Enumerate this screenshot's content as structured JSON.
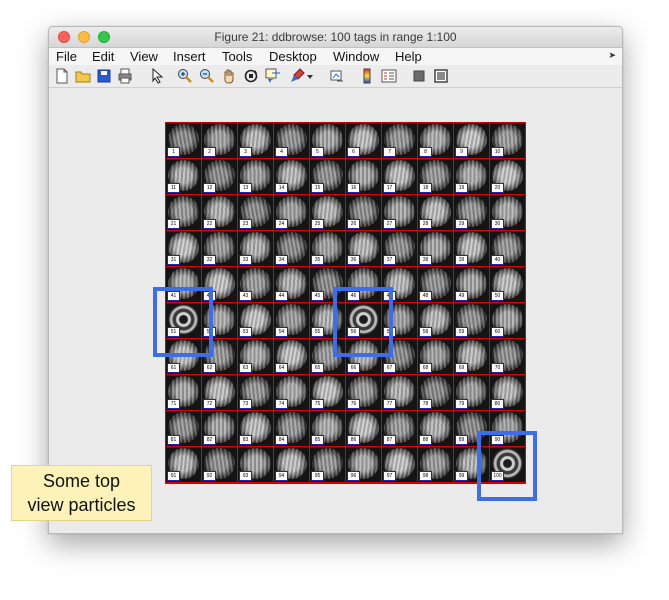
{
  "window": {
    "title": "Figure 21: ddbrowse: 100 tags in range 1:100"
  },
  "menu": {
    "items": [
      "File",
      "Edit",
      "View",
      "Insert",
      "Tools",
      "Desktop",
      "Window",
      "Help"
    ],
    "overflow_icon": "dock-arrow-icon"
  },
  "toolbar": {
    "buttons": [
      {
        "icon": "new-file-icon"
      },
      {
        "icon": "open-folder-icon"
      },
      {
        "icon": "save-icon"
      },
      {
        "icon": "print-icon"
      },
      {
        "icon": "pointer-icon"
      },
      {
        "icon": "zoom-in-icon"
      },
      {
        "icon": "zoom-out-icon"
      },
      {
        "icon": "pan-hand-icon"
      },
      {
        "icon": "rotate-3d-icon"
      },
      {
        "icon": "data-cursor-icon"
      },
      {
        "icon": "brush-icon"
      },
      {
        "icon": "brush-dropdown-icon"
      },
      {
        "icon": "link-plot-icon"
      },
      {
        "icon": "colorbar-icon"
      },
      {
        "icon": "legend-icon"
      },
      {
        "icon": "hide-plot-tools-icon"
      },
      {
        "icon": "show-plot-tools-icon"
      }
    ]
  },
  "gallery": {
    "tags": [
      "1",
      "2",
      "3",
      "4",
      "5",
      "6",
      "7",
      "8",
      "9",
      "10",
      "11",
      "12",
      "13",
      "14",
      "15",
      "16",
      "17",
      "18",
      "19",
      "20",
      "21",
      "22",
      "23",
      "24",
      "25",
      "26",
      "27",
      "28",
      "29",
      "30",
      "31",
      "32",
      "33",
      "34",
      "35",
      "36",
      "37",
      "38",
      "39",
      "40",
      "41",
      "42",
      "43",
      "44",
      "45",
      "46",
      "47",
      "48",
      "49",
      "50",
      "51",
      "52",
      "53",
      "54",
      "55",
      "56",
      "57",
      "58",
      "59",
      "60",
      "61",
      "62",
      "63",
      "64",
      "65",
      "66",
      "67",
      "68",
      "69",
      "70",
      "71",
      "72",
      "73",
      "74",
      "75",
      "76",
      "77",
      "78",
      "79",
      "80",
      "81",
      "82",
      "83",
      "84",
      "85",
      "86",
      "87",
      "88",
      "89",
      "90",
      "91",
      "92",
      "93",
      "94",
      "95",
      "96",
      "97",
      "98",
      "99",
      "100"
    ],
    "top_view_tags": [
      "51",
      "56",
      "100"
    ],
    "grid_color": "#e00000",
    "highlight_color": "#3d6de8"
  },
  "callout": {
    "line1": "Some top",
    "line2": "view particles",
    "background": "#fdf3b8"
  }
}
